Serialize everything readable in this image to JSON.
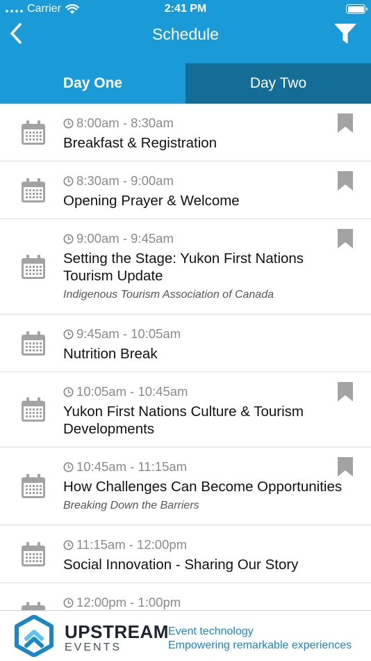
{
  "status_bar": {
    "carrier": "Carrier",
    "time": "2:41 PM"
  },
  "nav": {
    "title": "Schedule"
  },
  "tabs": [
    {
      "label": "Day One",
      "active": true
    },
    {
      "label": "Day Two",
      "active": false
    }
  ],
  "sessions": [
    {
      "time": "8:00am - 8:30am",
      "title": "Breakfast & Registration",
      "subtitle": "",
      "bookmarkable": true
    },
    {
      "time": "8:30am - 9:00am",
      "title": "Opening Prayer & Welcome",
      "subtitle": "",
      "bookmarkable": true
    },
    {
      "time": "9:00am - 9:45am",
      "title": "Setting the Stage: Yukon First Nations Tourism Update",
      "subtitle": "Indigenous Tourism Association of Canada",
      "bookmarkable": true
    },
    {
      "time": "9:45am - 10:05am",
      "title": "Nutrition Break",
      "subtitle": "",
      "bookmarkable": false
    },
    {
      "time": "10:05am - 10:45am",
      "title": "Yukon First Nations Culture & Tourism Developments",
      "subtitle": "",
      "bookmarkable": true
    },
    {
      "time": "10:45am - 11:15am",
      "title": "How Challenges Can Become Opportunities",
      "subtitle": "Breaking Down the Barriers",
      "bookmarkable": true
    },
    {
      "time": "11:15am - 12:00pm",
      "title": "Social Innovation - Sharing Our Story",
      "subtitle": "",
      "bookmarkable": false
    },
    {
      "time": "12:00pm - 1:00pm",
      "title": "",
      "subtitle": "",
      "bookmarkable": false
    }
  ],
  "banner": {
    "brand": "UPSTREAM",
    "brand_sub": "EVENTS",
    "tagline_1": "Event technology",
    "tagline_2": "Empowering remarkable experiences"
  },
  "colors": {
    "header_blue": "#1a9ad6",
    "tab_inactive": "#136d97",
    "icon_gray": "#a3a3a3",
    "brand_blue": "#1a86c8"
  },
  "icons": {
    "back": "chevron-left-icon",
    "filter": "funnel-icon",
    "row_icon": "calendar-icon",
    "time_icon": "clock-icon",
    "bookmark": "bookmark-icon"
  }
}
